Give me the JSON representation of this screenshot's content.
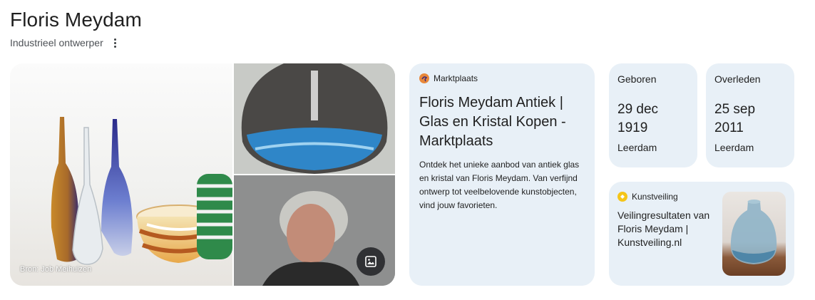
{
  "entity": {
    "name": "Floris Meydam",
    "subtitle": "Industrieel ontwerper"
  },
  "images": {
    "credit": "Bron: Job Meihuizen"
  },
  "marktplaats": {
    "source": "Marktplaats",
    "source_color": "#e8883a",
    "title": "Floris Meydam Antiek | Glas en Kristal Kopen - Marktplaats",
    "description": "Ontdek het unieke aanbod van antiek glas en kristal van Floris Meydam. Van verfijnd ontwerp tot veelbelovende kunstobjecten, vind jouw favorieten."
  },
  "born": {
    "label": "Geboren",
    "date": "29 dec 1919",
    "place": "Leerdam"
  },
  "died": {
    "label": "Overleden",
    "date": "25 sep 2011",
    "place": "Leerdam"
  },
  "kunstveiling": {
    "source": "Kunstveiling",
    "source_color": "#f5c518",
    "title": "Veilingresultaten van Floris Meydam | Kunstveiling.nl"
  },
  "colors": {
    "card_bg": "#e8f0f7",
    "text": "#1f1f1f"
  }
}
